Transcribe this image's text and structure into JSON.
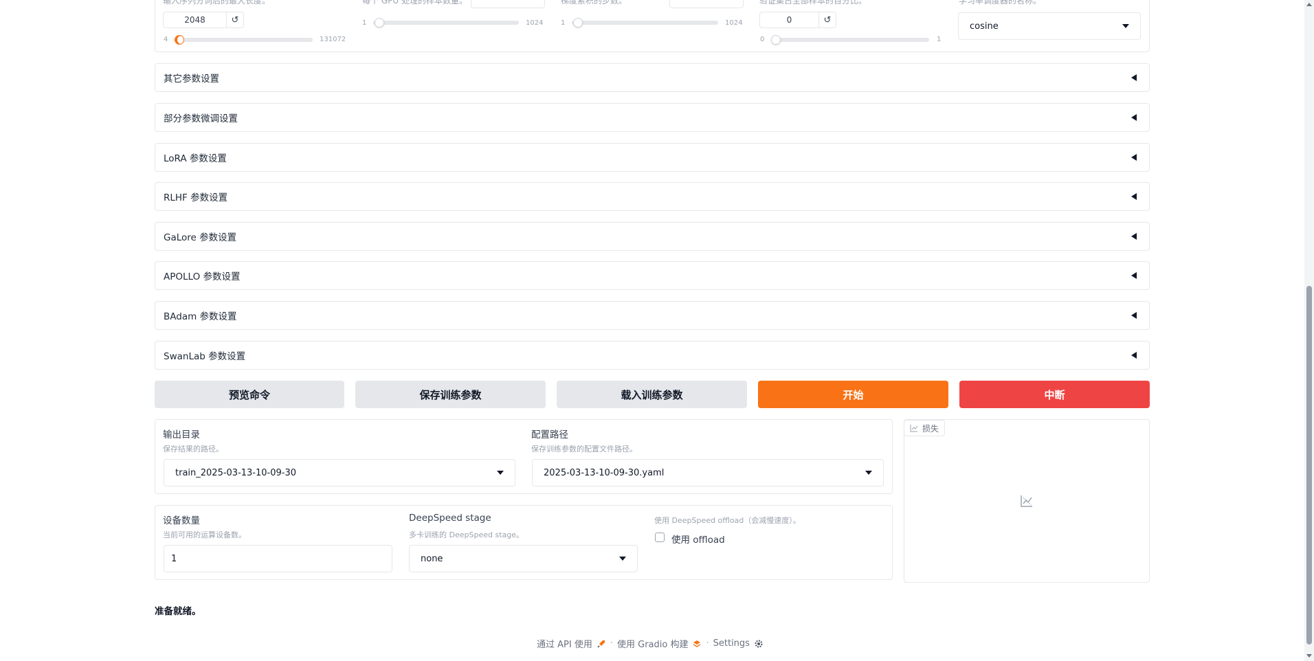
{
  "top_params": {
    "cutoff": {
      "label": "输入序列分词后的最大长度。",
      "value": "2048",
      "min": "4",
      "max": "131072"
    },
    "batch_size": {
      "label": "每个 GPU 处理的样本数量。",
      "min": "1",
      "max": "1024"
    },
    "grad_accum": {
      "label": "梯度累积的步数。",
      "min": "1",
      "max": "1024"
    },
    "val_size": {
      "label": "验证集占全部样本的百分比。",
      "value": "0",
      "min": "0",
      "max": "1"
    },
    "lr_scheduler": {
      "label": "学习率调度器的名称。",
      "value": "cosine"
    },
    "reset_icon": "↺"
  },
  "accordions": [
    {
      "label": "其它参数设置"
    },
    {
      "label": "部分参数微调设置"
    },
    {
      "label": "LoRA 参数设置"
    },
    {
      "label": "RLHF 参数设置"
    },
    {
      "label": "GaLore 参数设置"
    },
    {
      "label": "APOLLO 参数设置"
    },
    {
      "label": "BAdam 参数设置"
    },
    {
      "label": "SwanLab 参数设置"
    }
  ],
  "actions": {
    "preview": "预览命令",
    "save": "保存训练参数",
    "load": "载入训练参数",
    "start": "开始",
    "abort": "中断"
  },
  "output_dir": {
    "label": "输出目录",
    "info": "保存结果的路径。",
    "value": "train_2025-03-13-10-09-30"
  },
  "config_path": {
    "label": "配置路径",
    "info": "保存训练参数的配置文件路径。",
    "value": "2025-03-13-10-09-30.yaml"
  },
  "device_count": {
    "label": "设备数量",
    "info": "当前可用的运算设备数。",
    "value": "1"
  },
  "ds_stage": {
    "label": "DeepSpeed stage",
    "info": "多卡训练的 DeepSpeed stage。",
    "value": "none"
  },
  "ds_offload": {
    "info": "使用 DeepSpeed offload（会减慢速度）。",
    "label": "使用 offload"
  },
  "loss_plot": {
    "tab": "损失"
  },
  "status": "准备就绪。",
  "footer": {
    "api": "通过 API 使用",
    "built": "使用 Gradio 构建",
    "settings": "Settings"
  },
  "colors": {
    "accent": "#f97316",
    "danger": "#ef4444",
    "neutral_button": "#e5e7eb"
  }
}
